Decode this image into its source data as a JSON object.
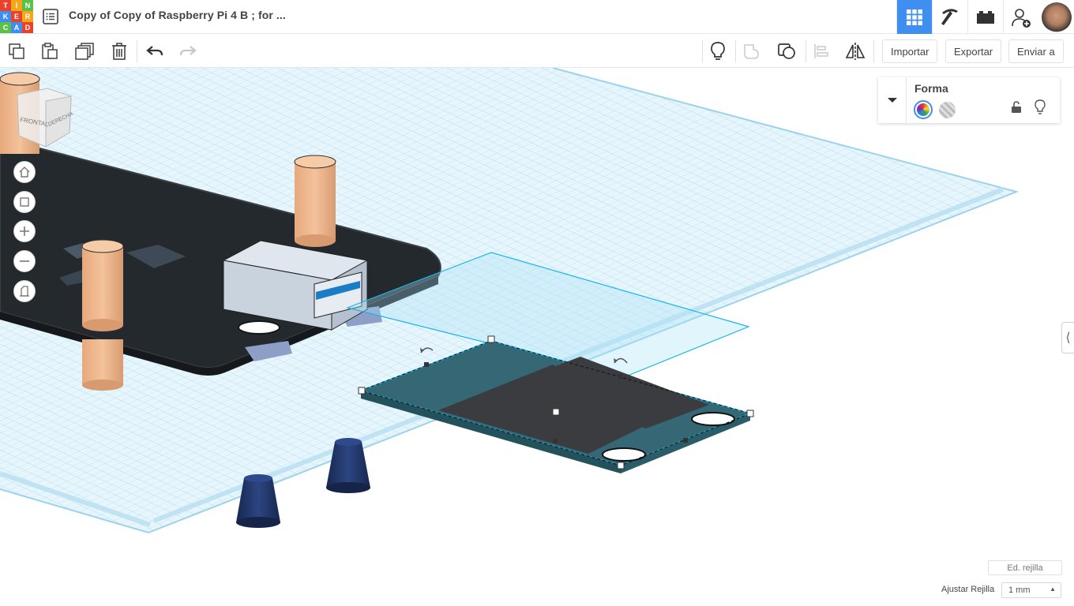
{
  "app": {
    "logo_letters": [
      "T",
      "I",
      "N",
      "K",
      "E",
      "R",
      "C",
      "A",
      "D"
    ],
    "logo_colors": [
      "#e9412b",
      "#f5a71c",
      "#5bbf4a",
      "#3f8ff0",
      "#e9412b",
      "#f5a71c",
      "#5bbf4a",
      "#3f8ff0",
      "#e9412b"
    ],
    "doc_title": "Copy of Copy of Raspberry Pi 4 B ; for ..."
  },
  "topbar": {
    "icons": [
      "grid-view-icon",
      "pickaxe-icon",
      "bricks-icon",
      "add-user-icon",
      "user-avatar"
    ],
    "active": "grid-view-icon",
    "accent": "#3f8ff0"
  },
  "toolbar": {
    "icons": [
      "copy-icon",
      "paste-icon",
      "duplicate-icon",
      "delete-icon",
      "undo-icon",
      "redo-icon",
      "notes-icon",
      "group-icon",
      "ungroup-icon",
      "align-icon",
      "mirror-icon"
    ],
    "import_label": "Importar",
    "export_label": "Exportar",
    "send_label": "Enviar a"
  },
  "viewcube": {
    "front": "FRONTAL",
    "right": "DERECHA"
  },
  "viewcontrols": [
    "home-view-icon",
    "fit-view-icon",
    "zoom-in-icon",
    "zoom-out-icon",
    "ortho-view-icon"
  ],
  "shape_panel": {
    "title": "Forma",
    "options": [
      "solid-color-icon",
      "hole-icon"
    ],
    "lock": "unlock-icon",
    "visibility": "bulb-icon"
  },
  "grid": {
    "edit_label": "Ed. rejilla",
    "snap_label": "Ajustar Rejilla",
    "snap_value": "1 mm"
  },
  "colors": {
    "grid_line": "#a9d8ee",
    "grid_fill": "#e7f5fc",
    "board": "#2b2f33",
    "standoff": "#f2b98c",
    "selected_part": "#356874",
    "selection_outline": "#18b6e8",
    "cone": "#1f3566"
  }
}
